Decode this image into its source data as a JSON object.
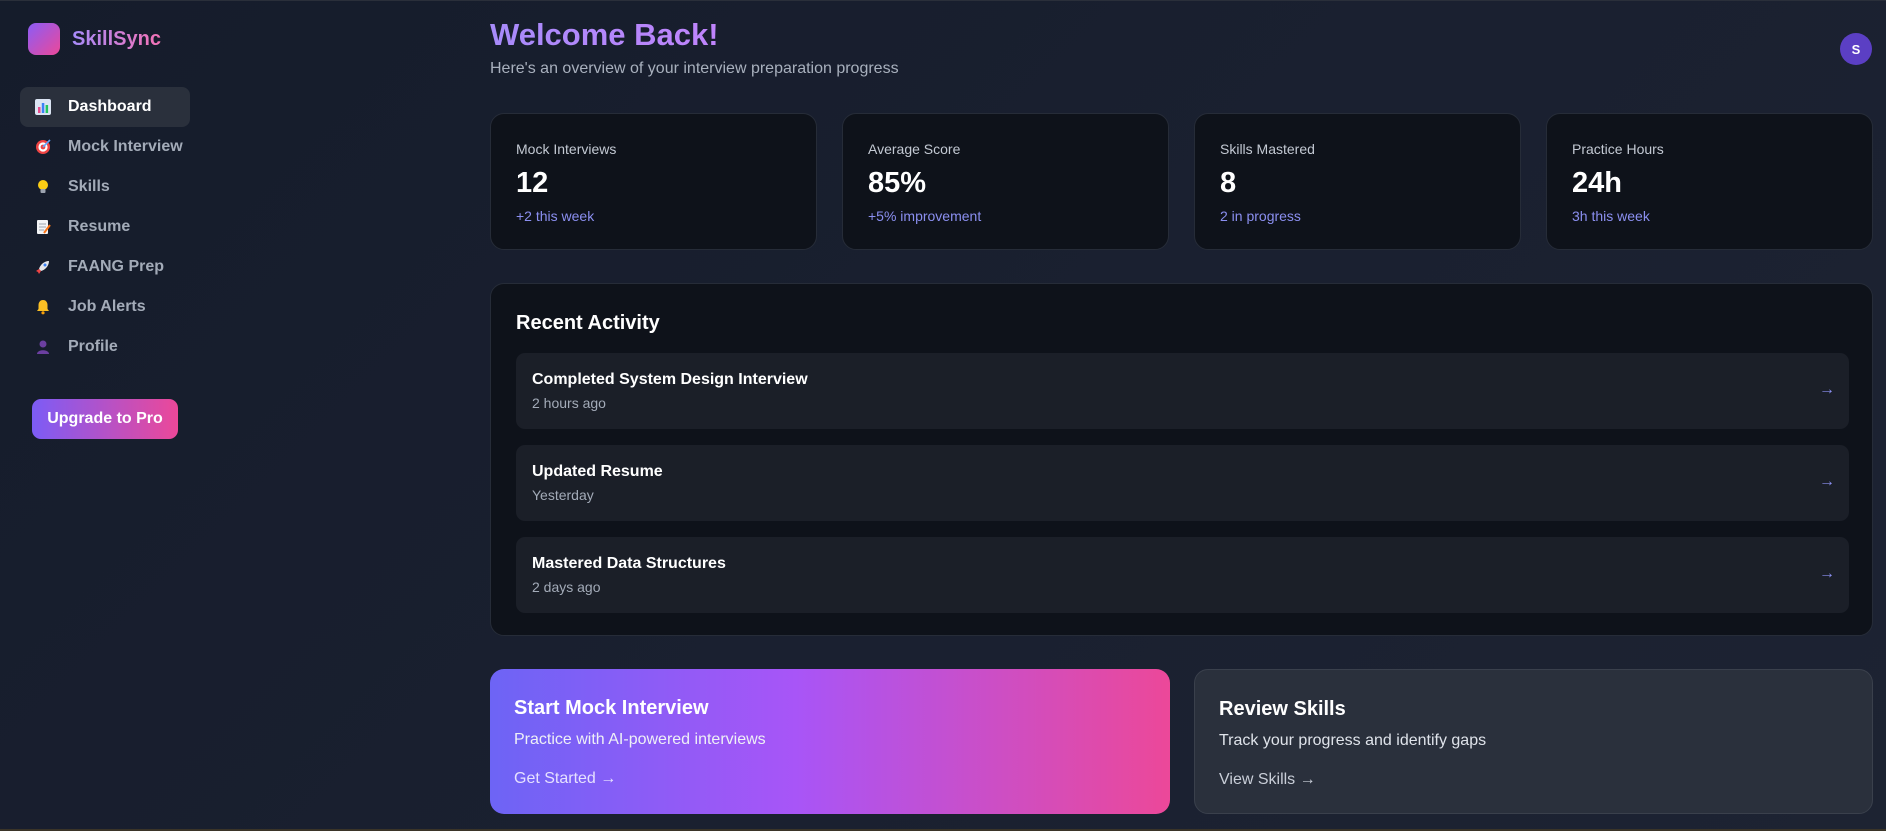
{
  "brand": {
    "name": "SkillSync"
  },
  "sidebar": {
    "items": [
      {
        "label": "Dashboard",
        "icon": "bar-chart-icon",
        "active": true
      },
      {
        "label": "Mock Interview",
        "icon": "target-icon"
      },
      {
        "label": "Skills",
        "icon": "lightbulb-icon"
      },
      {
        "label": "Resume",
        "icon": "memo-icon"
      },
      {
        "label": "FAANG Prep",
        "icon": "rocket-icon"
      },
      {
        "label": "Job Alerts",
        "icon": "bell-icon"
      },
      {
        "label": "Profile",
        "icon": "user-icon"
      }
    ],
    "upgrade_label": "Upgrade to Pro"
  },
  "header": {
    "title": "Welcome Back!",
    "subtitle": "Here's an overview of your interview preparation progress",
    "avatar_initial": "S"
  },
  "stats": [
    {
      "label": "Mock Interviews",
      "value": "12",
      "change": "+2 this week"
    },
    {
      "label": "Average Score",
      "value": "85%",
      "change": "+5% improvement"
    },
    {
      "label": "Skills Mastered",
      "value": "8",
      "change": "2 in progress"
    },
    {
      "label": "Practice Hours",
      "value": "24h",
      "change": "3h this week"
    }
  ],
  "activity": {
    "title": "Recent Activity",
    "items": [
      {
        "title": "Completed System Design Interview",
        "time": "2 hours ago",
        "arrow": "→"
      },
      {
        "title": "Updated Resume",
        "time": "Yesterday",
        "arrow": "→"
      },
      {
        "title": "Mastered Data Structures",
        "time": "2 days ago",
        "arrow": "→"
      }
    ]
  },
  "cards": {
    "mock": {
      "title": "Start Mock Interview",
      "desc": "Practice with AI-powered interviews",
      "link": "Get Started →"
    },
    "skills": {
      "title": "Review Skills",
      "desc": "Track your progress and identify gaps",
      "link": "View Skills →"
    }
  },
  "colors": {
    "accent": "#8b5cf6",
    "pink": "#ec4899",
    "link": "#8b8ff0"
  }
}
